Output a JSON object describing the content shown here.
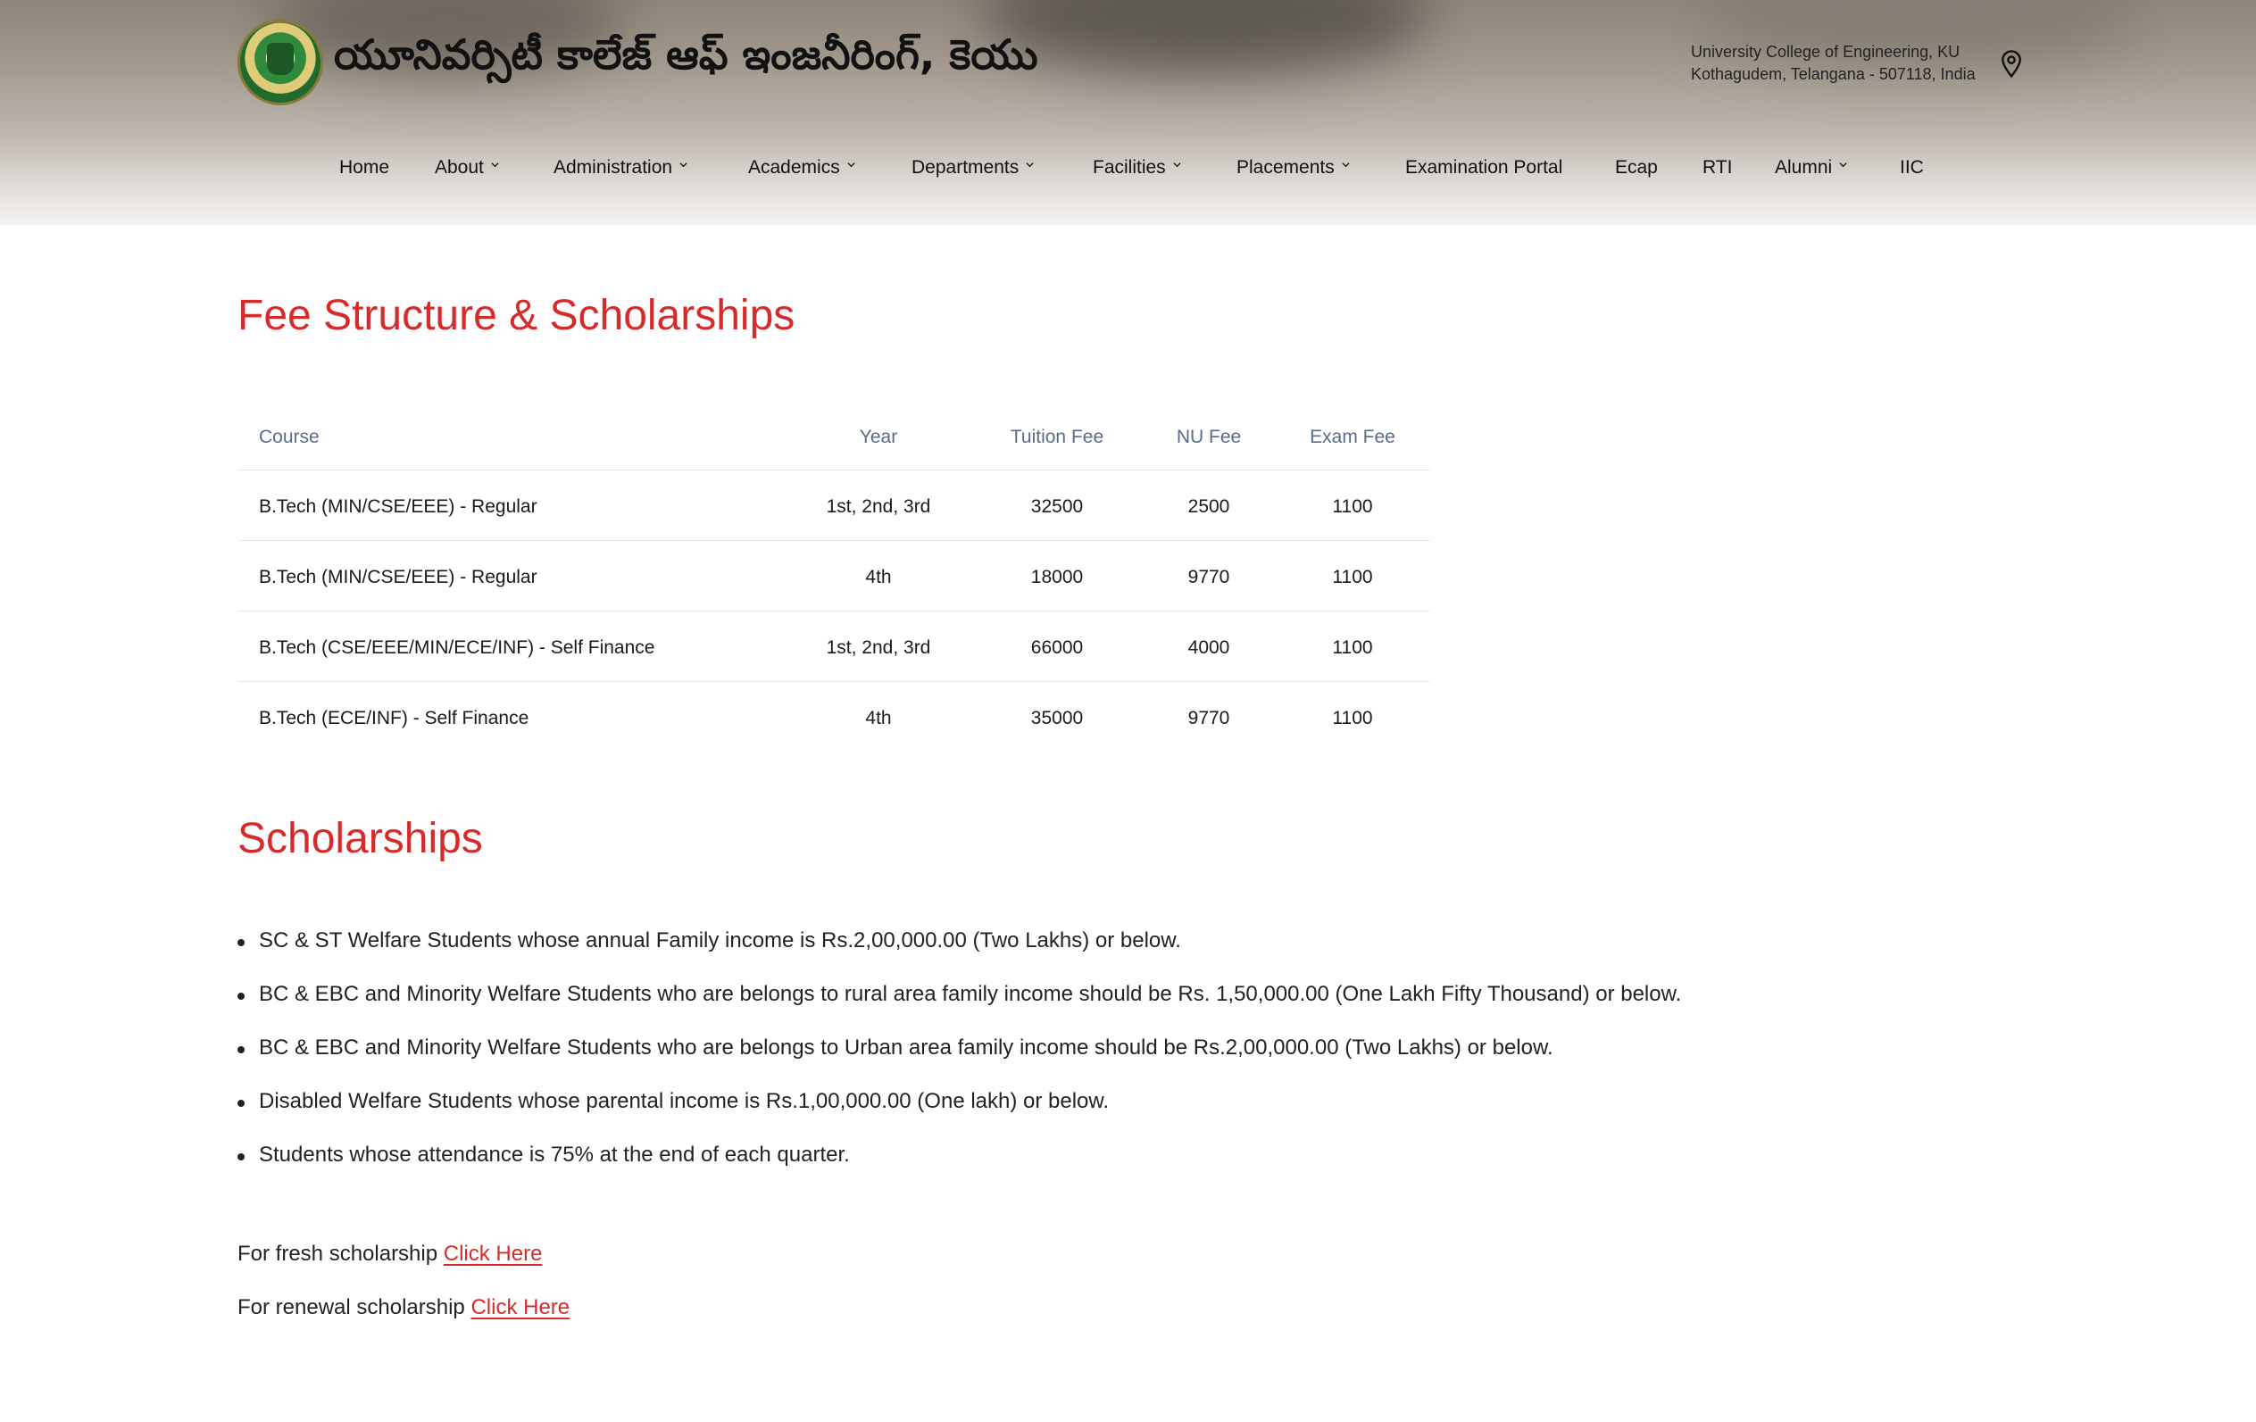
{
  "header": {
    "site_title": "యూనివర్సిటీ కాలేజ్ ఆఫ్ ఇంజనీరింగ్, కెయు",
    "address_line1": "University College of Engineering, KU",
    "address_line2": "Kothagudem, Telangana - 507118, India"
  },
  "nav": [
    {
      "label": "Home",
      "dropdown": false
    },
    {
      "label": "About",
      "dropdown": true
    },
    {
      "label": "Administration",
      "dropdown": true
    },
    {
      "label": "Academics",
      "dropdown": true
    },
    {
      "label": "Departments",
      "dropdown": true
    },
    {
      "label": "Facilities",
      "dropdown": true
    },
    {
      "label": "Placements",
      "dropdown": true
    },
    {
      "label": "Examination Portal",
      "dropdown": false
    },
    {
      "label": "Ecap",
      "dropdown": false
    },
    {
      "label": "RTI",
      "dropdown": false
    },
    {
      "label": "Alumni",
      "dropdown": true
    },
    {
      "label": "IIC",
      "dropdown": false
    }
  ],
  "fee": {
    "heading": "Fee Structure & Scholarships",
    "columns": [
      "Course",
      "Year",
      "Tuition Fee",
      "NU Fee",
      "Exam Fee"
    ],
    "rows": [
      [
        "B.Tech (MIN/CSE/EEE) - Regular",
        "1st, 2nd, 3rd",
        "32500",
        "2500",
        "1100"
      ],
      [
        "B.Tech (MIN/CSE/EEE) - Regular",
        "4th",
        "18000",
        "9770",
        "1100"
      ],
      [
        "B.Tech (CSE/EEE/MIN/ECE/INF) - Self Finance",
        "1st, 2nd, 3rd",
        "66000",
        "4000",
        "1100"
      ],
      [
        "B.Tech (ECE/INF) - Self Finance",
        "4th",
        "35000",
        "9770",
        "1100"
      ]
    ]
  },
  "scholarships": {
    "heading": "Scholarships",
    "items": [
      "SC & ST Welfare Students whose annual Family income is Rs.2,00,000.00 (Two Lakhs) or below.",
      "BC & EBC and Minority Welfare Students who are belongs to rural area family income should be Rs. 1,50,000.00 (One Lakh Fifty Thousand) or below.",
      "BC & EBC and Minority Welfare Students who are belongs to Urban area family income should be Rs.2,00,000.00 (Two Lakhs) or below.",
      "Disabled Welfare Students whose parental income is Rs.1,00,000.00 (One lakh) or below.",
      "Students whose attendance is 75% at the end of each quarter."
    ],
    "fresh_text": "For fresh scholarship",
    "fresh_link": "Click Here",
    "renewal_text": "For renewal scholarship",
    "renewal_link": "Click Here"
  },
  "colors": {
    "accent": "#d62b2b",
    "table_header": "#5a6b8a"
  },
  "icons": {
    "logo": "university-seal",
    "location": "map-pin-icon",
    "dropdown": "chevron-down-icon"
  }
}
